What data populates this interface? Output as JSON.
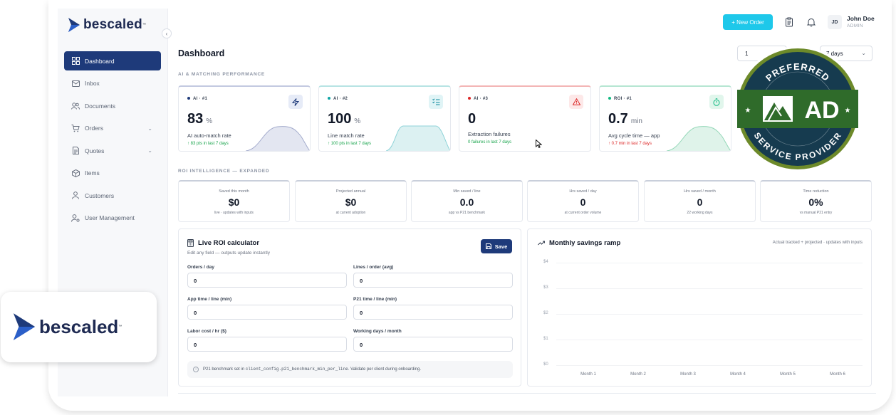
{
  "brand": {
    "name": "bescaled",
    "tm": "™"
  },
  "sidebar": {
    "collapse_icon": "chevron-left-icon",
    "items": [
      {
        "label": "Dashboard",
        "icon": "grid-icon",
        "active": true
      },
      {
        "label": "Inbox",
        "icon": "mail-icon"
      },
      {
        "label": "Documents",
        "icon": "users-icon"
      },
      {
        "label": "Orders",
        "icon": "cart-icon",
        "chevron": true
      },
      {
        "label": "Quotes",
        "icon": "file-icon",
        "chevron": true
      },
      {
        "label": "Items",
        "icon": "box-icon"
      },
      {
        "label": "Customers",
        "icon": "user-icon"
      },
      {
        "label": "User Management",
        "icon": "user-gear-icon"
      }
    ]
  },
  "topbar": {
    "new_order": "+ New Order",
    "user": {
      "initials": "JD",
      "name": "John Doe",
      "role": "ADMIN"
    }
  },
  "page": {
    "title": "Dashboard",
    "filter_left": "1",
    "filter_right": "7 days"
  },
  "section_ai": "AI & MATCHING PERFORMANCE",
  "kpis": [
    {
      "tag": "AI · #1",
      "value": "83",
      "unit": "%",
      "label": "AI auto-match rate",
      "sub": "↑ 83 pts in last 7 days",
      "color": "#1e3a7a",
      "icon": "bolt-icon"
    },
    {
      "tag": "AI · #2",
      "value": "100",
      "unit": "%",
      "label": "Line match rate",
      "sub": "↑ 100 pts in last 7 days",
      "color": "#0ea5a5",
      "icon": "list-check-icon"
    },
    {
      "tag": "AI · #3",
      "value": "0",
      "unit": "",
      "label": "Extraction failures",
      "sub": "0 failures in last 7 days",
      "color": "#dc2626",
      "icon": "warning-icon"
    },
    {
      "tag": "ROI · #1",
      "value": "0.7",
      "unit": "min",
      "label": "Avg cycle time — app",
      "sub": "↑ 0.7 min in last 7 days",
      "color": "#10b981",
      "icon": "stopwatch-icon"
    }
  ],
  "section_roi": "ROI INTELLIGENCE — EXPANDED",
  "roi": [
    {
      "label": "Saved this month",
      "value": "$0",
      "sub": "live · updates with inputs"
    },
    {
      "label": "Projected annual",
      "value": "$0",
      "sub": "at current adoption"
    },
    {
      "label": "Min saved / line",
      "value": "0.0",
      "sub": "app vs P21 benchmark"
    },
    {
      "label": "Hrs saved / day",
      "value": "0",
      "sub": "at current order volume"
    },
    {
      "label": "Hrs saved / month",
      "value": "0",
      "sub": "22 working days"
    },
    {
      "label": "Time reduction",
      "value": "0%",
      "sub": "vs manual P21 entry"
    }
  ],
  "calculator": {
    "title": "Live ROI calculator",
    "subtitle": "Edit any field — outputs update instantly",
    "save": "Save",
    "fields": [
      {
        "label": "Orders / day",
        "value": "0"
      },
      {
        "label": "Lines / order (avg)",
        "value": "0"
      },
      {
        "label": "App time / line (min)",
        "value": "0"
      },
      {
        "label": "P21 time / line (min)",
        "value": "0"
      },
      {
        "label": "Labor cost / hr ($)",
        "value": "0"
      },
      {
        "label": "Working days / month",
        "value": "0"
      }
    ],
    "note_pre": "P21 benchmark set in ",
    "note_code": "client_config.p21_benchmark_min_per_line",
    "note_post": ". Validate per client during onboarding."
  },
  "chart_data": {
    "type": "line",
    "title": "Monthly savings ramp",
    "note": "Actual tracked + projected · updates with inputs",
    "categories": [
      "Month 1",
      "Month 2",
      "Month 3",
      "Month 4",
      "Month 5",
      "Month 6"
    ],
    "y_ticks": [
      "$4",
      "$3",
      "$2",
      "$1",
      "$0"
    ],
    "ylim": [
      0,
      4
    ],
    "series": [],
    "grid": true
  },
  "badge": {
    "top": "PREFERRED",
    "center": "AD",
    "bottom": "SERVICE PROVIDER",
    "green": "#2f6b2a",
    "navy": "#163b4f"
  }
}
